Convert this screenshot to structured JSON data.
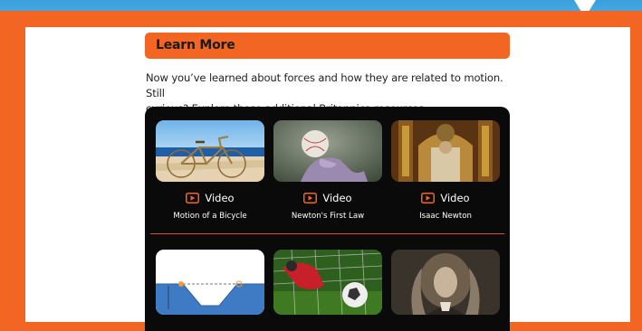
{
  "section": {
    "title": "Learn More",
    "intro_line1": "Now you’ve learned about forces and how they are related to motion. Still",
    "intro_line2": "curious? Explore these additional Britannica resources."
  },
  "resources": [
    {
      "type": "Video",
      "title": "Motion of a Bicycle",
      "icon": "play-icon"
    },
    {
      "type": "Video",
      "title": "Newton's First Law",
      "icon": "play-icon"
    },
    {
      "type": "Video",
      "title": "Isaac Newton",
      "icon": "play-icon"
    }
  ],
  "more_resources": [
    {
      "image": "pendulum-diagram-thumbnail"
    },
    {
      "image": "soccer-goalkeeper-thumbnail"
    },
    {
      "image": "isaac-newton-portrait-thumbnail"
    }
  ],
  "colors": {
    "accent": "#f26522",
    "panel": "#0a0a0a",
    "sky": "#3aa0dc"
  }
}
